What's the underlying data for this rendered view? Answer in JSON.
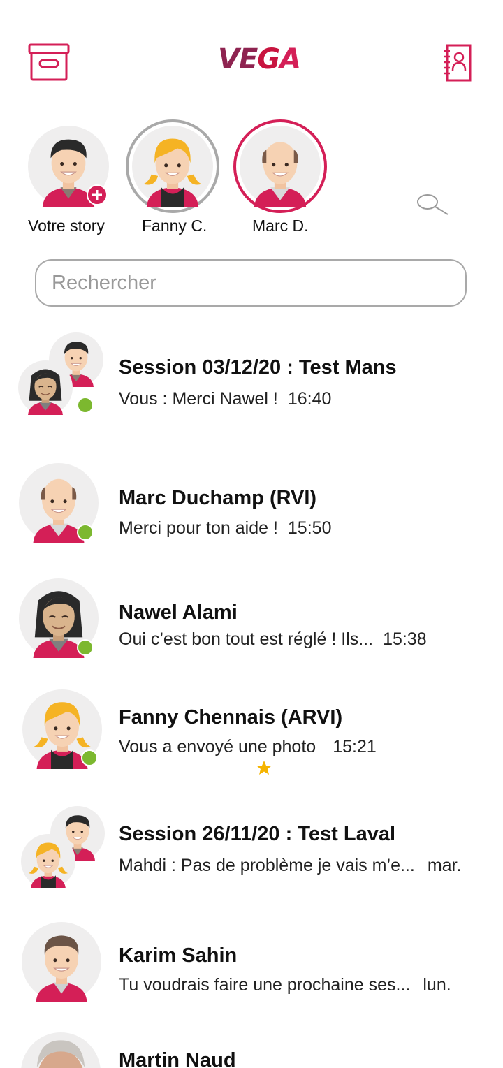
{
  "header": {
    "logo": {
      "part1": "VE",
      "part2": "G",
      "part3": "A"
    },
    "left_icon": "archive-box-icon",
    "right_icon": "contacts-book-icon",
    "accent_color": "#d41f57"
  },
  "stories": [
    {
      "label": "Votre story",
      "avatar": "young-man-avatar"
    },
    {
      "label": "Fanny C.",
      "avatar": "blonde-woman-avatar"
    },
    {
      "label": "Marc D.",
      "avatar": "bald-man-avatar"
    }
  ],
  "search": {
    "placeholder": "Rechercher",
    "icon": "search-icon"
  },
  "conversations": [
    {
      "title": "Session 03/12/20 : Test Mans",
      "message": "Vous : Merci Nawel !",
      "time": "16:40"
    },
    {
      "title": "Marc Duchamp (RVI)",
      "message": "Merci pour ton aide !",
      "time": "15:50"
    },
    {
      "title": "Nawel Alami",
      "message": "Oui c’est bon tout est réglé ! Ils...",
      "time": "15:38"
    },
    {
      "title": "Fanny Chennais (ARVI)",
      "message": "Vous a envoyé une photo",
      "time": "15:21"
    },
    {
      "title": "Session 26/11/20 : Test Laval",
      "message": "Mahdi : Pas de problème je vais m’e...",
      "time": "mar."
    },
    {
      "title": "Karim Sahin",
      "message": "Tu voudrais faire une prochaine ses...",
      "time": "lun."
    },
    {
      "title": "Martin Naud",
      "message": "",
      "time": ""
    }
  ],
  "colors": {
    "online": "#7cb82f",
    "star": "#f5b400",
    "search_border": "#a9a9a9"
  }
}
